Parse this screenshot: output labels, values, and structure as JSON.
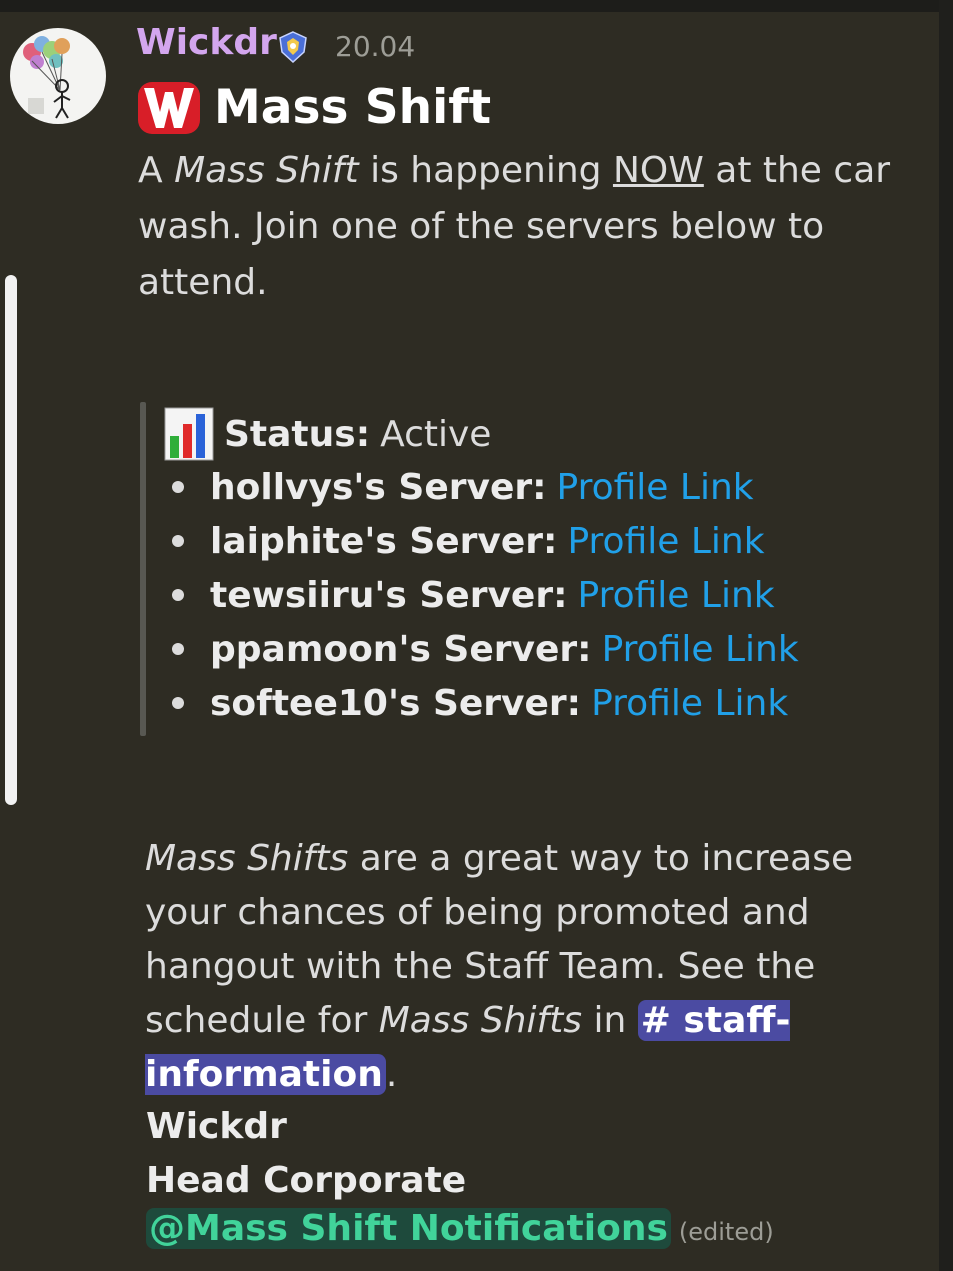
{
  "message": {
    "author": "Wickdr",
    "timestamp": "20.04",
    "title": "Mass Shift",
    "intro": {
      "part1": "A ",
      "italic": "Mass Shift",
      "part2": " is happening ",
      "underline": "NOW",
      "part3": " at the car wash. Join one of the servers below to attend."
    },
    "status": {
      "label": "Status:",
      "value": "Active"
    },
    "servers": [
      {
        "name": "hollvys's Server:",
        "link": "Profile Link"
      },
      {
        "name": "laiphite's Server:",
        "link": "Profile Link"
      },
      {
        "name": "tewsiiru's Server:",
        "link": "Profile Link"
      },
      {
        "name": "ppamoon's Server:",
        "link": "Profile Link"
      },
      {
        "name": "softee10's Server:",
        "link": "Profile Link"
      }
    ],
    "outro": {
      "italic1": "Mass Shifts",
      "part1": " are a great way to increase your chances of being promoted and hangout with the Staff Team. See the schedule for ",
      "italic2": "Mass Shifts",
      "part2": " in ",
      "channel": "# staff-information",
      "part3": "."
    },
    "signature": {
      "name": "Wickdr",
      "role": "Head Corporate"
    },
    "role_mention": "@Mass Shift Notifications",
    "edited_label": "(edited)"
  },
  "colors": {
    "background": "#2e2c23",
    "username": "#d3a6ee",
    "link": "#21a0e8",
    "channel_mention_bg": "#4b4ba2",
    "role_mention_bg": "#1e4a3c",
    "role_mention_text": "#41d39a"
  },
  "icons": {
    "avatar": "balloon-avatar",
    "role_badge": "shield-badge-icon",
    "title_emoji": "letter-w-icon",
    "status_emoji": "bar-chart-icon"
  }
}
